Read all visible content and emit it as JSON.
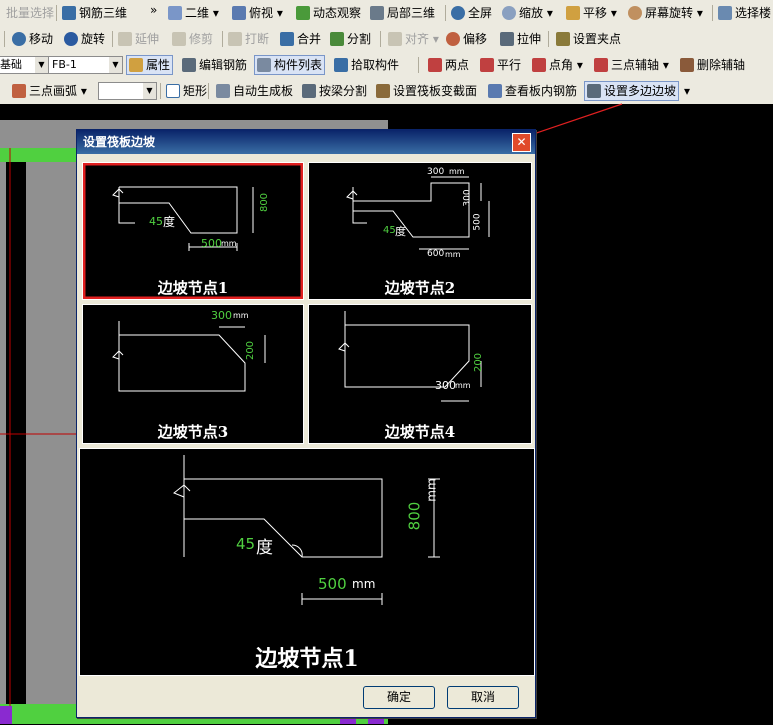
{
  "toolbar1": {
    "batch_select": "批量选择",
    "rebar_3d": "钢筋三维",
    "more": "»",
    "view_2d": "二维",
    "top_view": "俯视",
    "dynamic_observe": "动态观察",
    "local_3d": "局部三维",
    "fullscreen": "全屏",
    "zoom": "缩放",
    "pan": "平移",
    "screen_rotate": "屏幕旋转",
    "select_floor": "选择楼"
  },
  "toolbar2": {
    "move": "移动",
    "rotate": "旋转",
    "extend": "延伸",
    "trim": "修剪",
    "break": "打断",
    "merge": "合并",
    "split": "分割",
    "align": "对齐",
    "offset": "偏移",
    "stretch": "拉伸",
    "set_grip": "设置夹点"
  },
  "toolbar3": {
    "foundation": "基础",
    "component_value": "FB-1",
    "properties": "属性",
    "edit_rebar": "编辑钢筋",
    "component_list": "构件列表",
    "pick_component": "拾取构件",
    "two_points": "两点",
    "parallel": "平行",
    "point_angle": "点角",
    "three_point_axis": "三点辅轴",
    "delete_axis": "删除辅轴"
  },
  "toolbar4": {
    "three_point_arc": "三点画弧",
    "rect": "矩形",
    "auto_generate": "自动生成板",
    "split_by_beam": "按梁分割",
    "set_section": "设置筏板变截面",
    "view_rebar": "查看板内钢筋",
    "set_slope": "设置多边边坡"
  },
  "dialog": {
    "title": "设置筏板边坡",
    "close": "✕",
    "ok": "确定",
    "cancel": "取消",
    "nodes": [
      {
        "label": "边坡节点1",
        "angle": "45",
        "deg": "度",
        "dim_w": "500",
        "dim_h": "800",
        "unit": "mm"
      },
      {
        "label": "边坡节点2",
        "angle": "45",
        "deg": "度",
        "dim_top": "300",
        "dim_side": "300",
        "dim_h": "500",
        "dim_w": "600",
        "unit": "mm"
      },
      {
        "label": "边坡节点3",
        "dim_w": "300",
        "dim_h": "200",
        "unit": "mm"
      },
      {
        "label": "边坡节点4",
        "dim_w": "300",
        "dim_h": "200",
        "unit": "mm"
      }
    ],
    "preview": {
      "label": "边坡节点1",
      "angle": "45",
      "deg": "度",
      "dim_w": "500",
      "dim_h": "800",
      "unit": "mm"
    }
  },
  "colors": {
    "accent_green": "#00c000",
    "highlight_red": "#e02020",
    "canvas_grid": "#c00000"
  }
}
